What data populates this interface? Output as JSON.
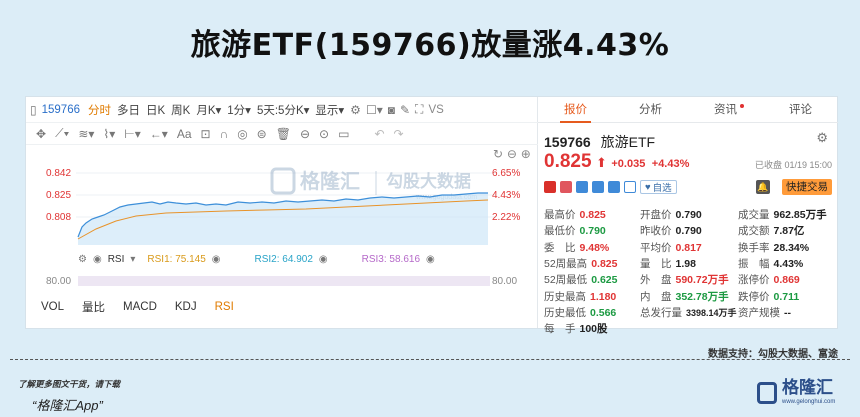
{
  "headline": "旅游ETF(159766)放量涨4.43%",
  "toolbar": {
    "code": "159766",
    "periods": [
      "分时",
      "多日",
      "日K",
      "周K",
      "月K▾",
      "1分▾",
      "5天:5分K▾",
      "显示▾"
    ],
    "vs_label": "VS"
  },
  "chart": {
    "y_left": [
      "0.842",
      "0.825",
      "0.808"
    ],
    "y_right": [
      "6.65%",
      "4.43%",
      "2.22%"
    ],
    "rsi_label": "RSI",
    "rsi1": "RSI1: 75.145",
    "rsi2": "RSI2: 64.902",
    "rsi3": "RSI3: 58.616",
    "rsi_left_axis": "80.00",
    "rsi_right_axis": "80.00",
    "watermark": "格隆汇",
    "watermark2": "勾股大数据",
    "watermark_url": "www.gogudata.com"
  },
  "indicators": [
    "VOL",
    "量比",
    "MACD",
    "KDJ",
    "RSI"
  ],
  "tabs": [
    "报价",
    "分析",
    "资讯",
    "评论"
  ],
  "quote": {
    "code": "159766",
    "name": "旅游ETF",
    "price": "0.825",
    "change": "+0.035",
    "change_pct": "+4.43%",
    "status": "已收盘 01/19 15:00",
    "watch_label": "自选",
    "trade_label": "快捷交易"
  },
  "stats": {
    "col1": [
      [
        "最高价",
        "0.825"
      ],
      [
        "最低价",
        "0.790"
      ],
      [
        "委　比",
        "9.48%"
      ],
      [
        "52周最高",
        "0.825"
      ],
      [
        "52周最低",
        "0.625"
      ],
      [
        "历史最高",
        "1.180"
      ],
      [
        "历史最低",
        "0.566"
      ],
      [
        "每　手",
        "100股"
      ]
    ],
    "col2": [
      [
        "开盘价",
        "0.790"
      ],
      [
        "昨收价",
        "0.790"
      ],
      [
        "平均价",
        "0.817"
      ],
      [
        "量　比",
        "1.98"
      ],
      [
        "外　盘",
        "590.72万手"
      ],
      [
        "内　盘",
        "352.78万手"
      ],
      [
        "总发行量",
        "3398.14万手"
      ]
    ],
    "col3": [
      [
        "成交量",
        "962.85万手"
      ],
      [
        "成交额",
        "7.87亿"
      ],
      [
        "换手率",
        "28.34%"
      ],
      [
        "振　幅",
        "4.43%"
      ],
      [
        "涨停价",
        "0.869"
      ],
      [
        "跌停价",
        "0.711"
      ],
      [
        "资产规模",
        "--"
      ]
    ]
  },
  "footer": {
    "data_support": "数据支持：勾股大数据、富途",
    "note": "了解更多图文干货，请下载",
    "app": "“格隆汇App”",
    "logo_text": "格隆汇",
    "logo_url": "www.gelonghui.com"
  }
}
